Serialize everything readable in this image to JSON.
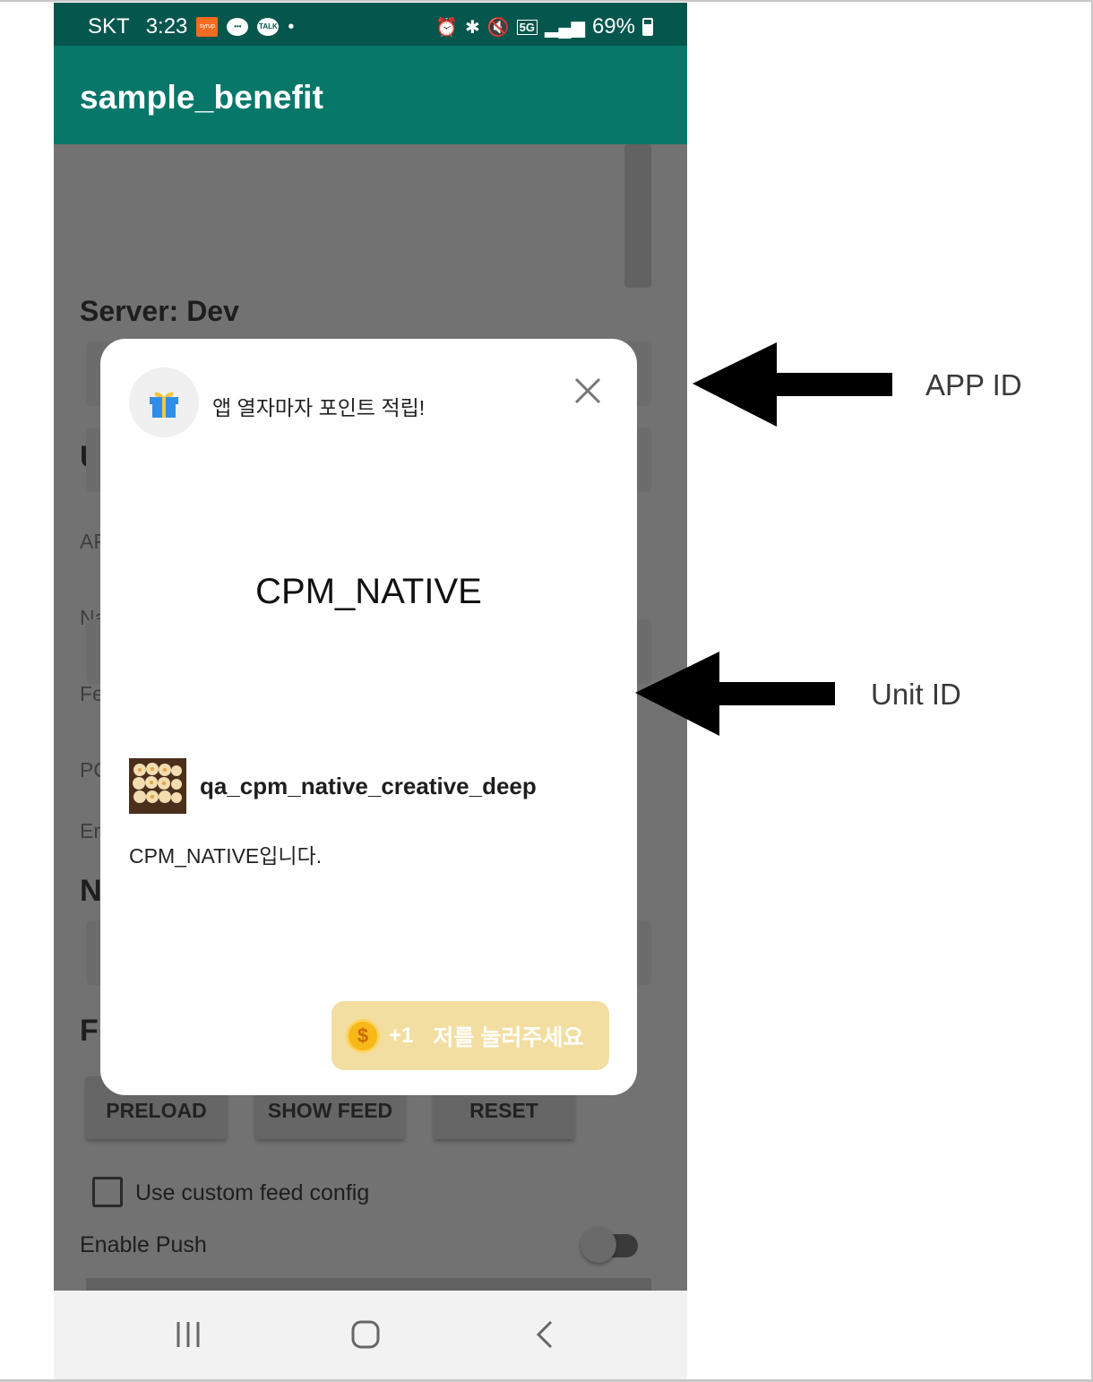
{
  "status_bar": {
    "carrier": "SKT",
    "time": "3:23",
    "notif_app_badge": "syrup",
    "notif_talk_badge": "TALK",
    "dot": "•",
    "network": "5G",
    "battery": "69%"
  },
  "app_bar": {
    "title": "sample_benefit"
  },
  "background_form": {
    "server_label": "Server: Dev",
    "section_heading_1": "U",
    "field_label_1": "AP",
    "field_label_2": "Na",
    "field_label_3": "Fe",
    "field_label_4": "PO",
    "field_label_5": "En",
    "section_heading_2": "N",
    "section_heading_3": "F",
    "buttons": [
      "PRELOAD",
      "SHOW FEED",
      "RESET"
    ],
    "checkbox_label": "Use custom feed config",
    "push_label": "Enable Push",
    "push_enabled": false
  },
  "dialog": {
    "headline": "앱 열자마자 포인트 적립!",
    "creative_title": "CPM_NATIVE",
    "ad_title": "qa_cpm_native_creative_deep",
    "ad_description": "CPM_NATIVE입니다.",
    "cta_reward": "+1",
    "cta_text": "저를 눌러주세요",
    "coin_symbol": "$"
  },
  "annotations": {
    "app_id_label": "APP ID",
    "unit_id_label": "Unit ID"
  },
  "colors": {
    "status_bar": "#05564d",
    "app_bar": "#07776a",
    "scrim": "#727272",
    "cta_background": "#f3dea1",
    "coin": "#f7b81a"
  },
  "icons": {
    "gift": "gift-icon",
    "close": "close-icon",
    "coin": "coin-icon",
    "nav_recents": "recents-icon",
    "nav_home": "home-icon",
    "nav_back": "back-icon"
  }
}
